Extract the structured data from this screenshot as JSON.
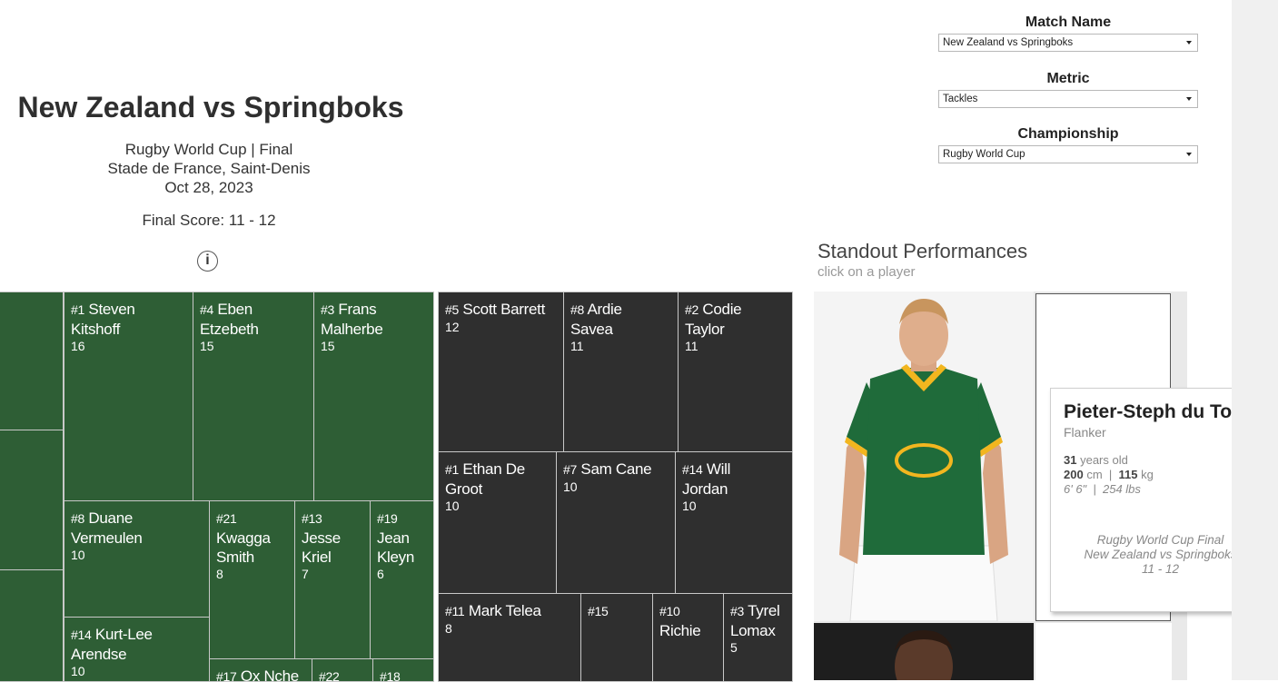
{
  "header": {
    "title": "New Zealand vs Springboks",
    "competition": "Rugby World Cup | Final",
    "venue": "Stade de France, Saint-Denis",
    "date": "Oct 28, 2023",
    "final_score": "Final Score: 11 - 12",
    "info_icon": "i"
  },
  "filters": {
    "match": {
      "label": "Match Name",
      "value": "New Zealand vs Springboks"
    },
    "metric": {
      "label": "Metric",
      "value": "Tackles"
    },
    "championship": {
      "label": "Championship",
      "value": "Rugby World Cup"
    }
  },
  "standout": {
    "title": "Standout Performances",
    "subtitle": "click on a player"
  },
  "tooltip": {
    "name": "Pieter-Steph du Toit",
    "position": "Flanker",
    "age_value": "31",
    "age_unit": "years old",
    "height_cm": "200",
    "height_unit": "cm",
    "sep": "|",
    "weight_kg": "115",
    "weight_unit": "kg",
    "imperial": "6' 6\"  |  254 lbs",
    "footer_line1": "Rugby World Cup Final",
    "footer_line2": "New Zealand vs Springboks",
    "footer_line3": "11 - 12"
  },
  "colors": {
    "springboks_tile": "#2e5e35",
    "all_blacks_tile": "#2f2f2f",
    "jersey_green": "#1f6b3a",
    "jersey_gold": "#f2b61f"
  },
  "treemap": {
    "springboks": [
      {
        "num": "#1",
        "name": "Steven Kitshoff",
        "line1": "Steven",
        "line2": "Kitshoff",
        "value": "16"
      },
      {
        "num": "#4",
        "name": "Eben Etzebeth",
        "line1": "Eben",
        "line2": "Etzebeth",
        "value": "15"
      },
      {
        "num": "#3",
        "name": "Frans Malherbe",
        "line1": "Frans",
        "line2": "Malherbe",
        "value": "15"
      },
      {
        "num": "#8",
        "name": "Duane Vermeulen",
        "line1": "Duane",
        "line2": "Vermeulen",
        "value": "10"
      },
      {
        "num": "#21",
        "name": "Kwagga Smith",
        "line1": "",
        "line2": "Kwagga",
        "line3": "Smith",
        "value": "8"
      },
      {
        "num": "#13",
        "name": "Jesse Kriel",
        "line1": "",
        "line2": "Jesse",
        "line3": "Kriel",
        "value": "7"
      },
      {
        "num": "#19",
        "name": "Jean Kleyn",
        "line1": "",
        "line2": "Jean",
        "line3": "Kleyn",
        "value": "6"
      },
      {
        "num": "#14",
        "name": "Kurt-Lee Arendse",
        "line1": "Kurt-Lee",
        "line2": "Arendse",
        "value": "10"
      },
      {
        "num": "#17",
        "name": "Ox Nche",
        "line1": "Ox Nche",
        "value": ""
      },
      {
        "num": "#22",
        "name": "",
        "value": ""
      },
      {
        "num": "#18",
        "name": "",
        "value": ""
      }
    ],
    "all_blacks": [
      {
        "num": "#5",
        "name": "Scott Barrett",
        "line1": "Scott Barrett",
        "value": "12"
      },
      {
        "num": "#8",
        "name": "Ardie Savea",
        "line1": "Ardie",
        "line2": "Savea",
        "value": "11"
      },
      {
        "num": "#2",
        "name": "Codie Taylor",
        "line1": "Codie",
        "line2": "Taylor",
        "value": "11"
      },
      {
        "num": "#1",
        "name": "Ethan De Groot",
        "line1": "Ethan De",
        "line2": "Groot",
        "value": "10"
      },
      {
        "num": "#7",
        "name": "Sam Cane",
        "line1": "Sam Cane",
        "value": "10"
      },
      {
        "num": "#14",
        "name": "Will Jordan",
        "line1": "Will",
        "line2": "Jordan",
        "value": "10"
      },
      {
        "num": "#11",
        "name": "Mark Telea",
        "line1": "Mark Telea",
        "value": "8"
      },
      {
        "num": "#15",
        "name": "",
        "value": ""
      },
      {
        "num": "#10",
        "name": "Richie",
        "line1": "",
        "line2": "Richie",
        "value": ""
      },
      {
        "num": "#3",
        "name": "Tyrel Lomax",
        "line1": "Tyrel",
        "line2": "Lomax",
        "value": "5"
      }
    ]
  }
}
